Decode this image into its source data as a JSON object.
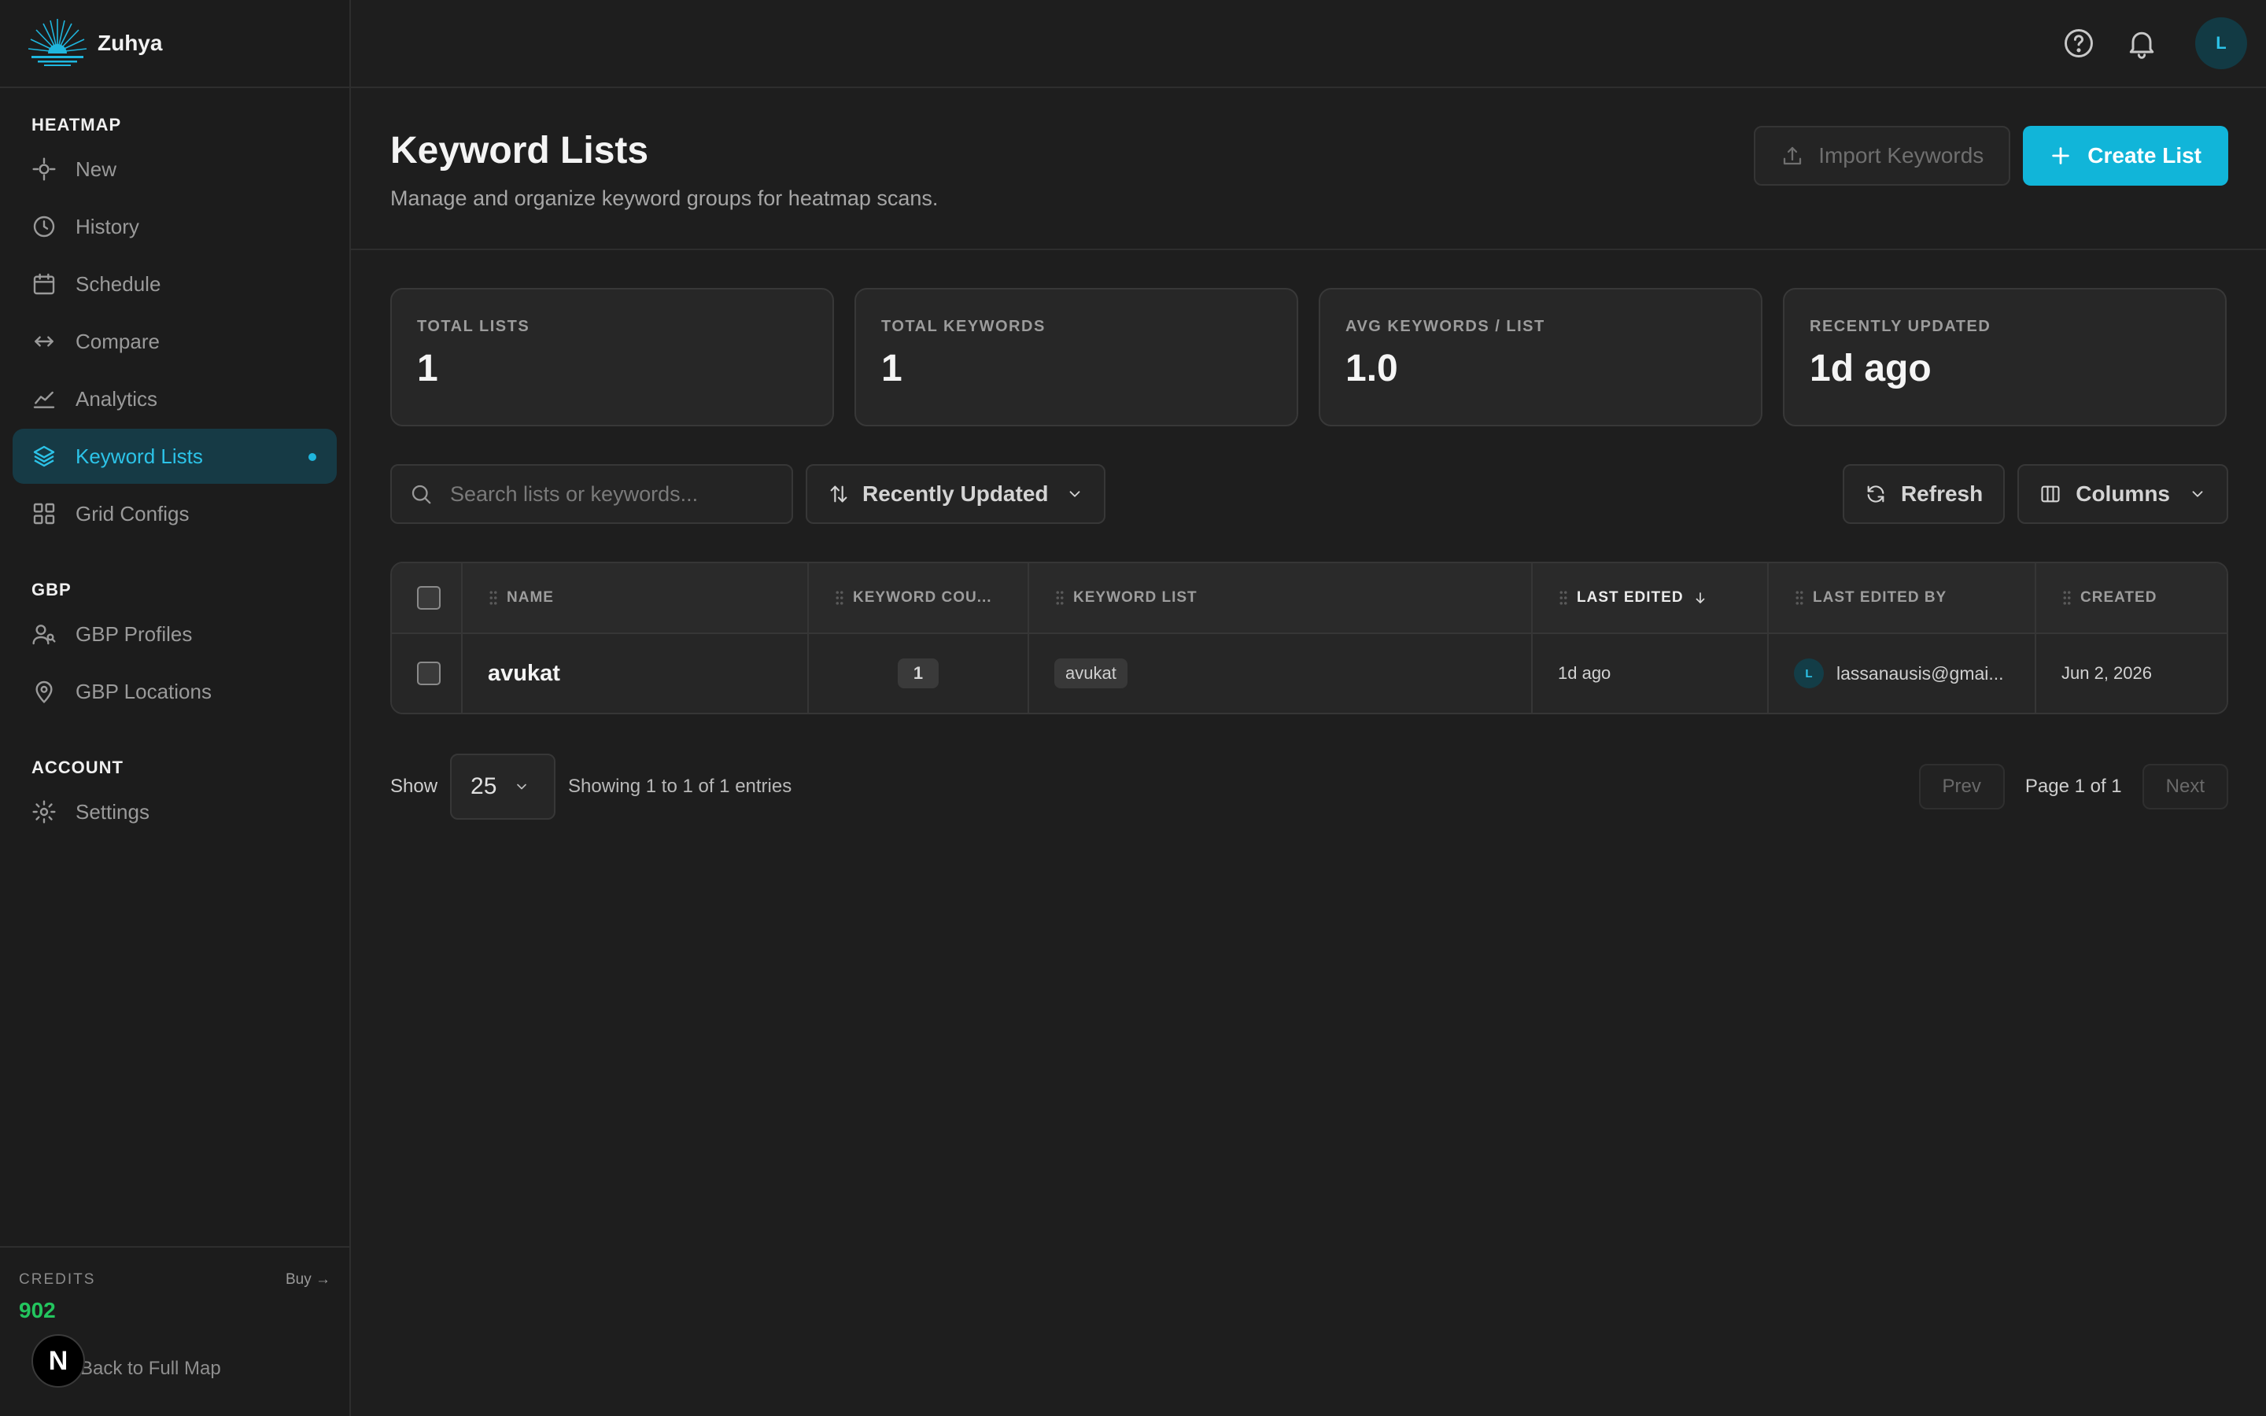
{
  "brand": {
    "name": "Zuhya"
  },
  "sidebar": {
    "sections": [
      {
        "heading": "HEATMAP",
        "items": [
          {
            "label": "New",
            "icon": "crosshair-icon"
          },
          {
            "label": "History",
            "icon": "clock-icon"
          },
          {
            "label": "Schedule",
            "icon": "calendar-icon"
          },
          {
            "label": "Compare",
            "icon": "arrows-horizontal-icon"
          },
          {
            "label": "Analytics",
            "icon": "line-chart-icon"
          },
          {
            "label": "Keyword Lists",
            "icon": "layers-icon",
            "active": true
          },
          {
            "label": "Grid Configs",
            "icon": "grid-icon"
          }
        ]
      },
      {
        "heading": "GBP",
        "items": [
          {
            "label": "GBP Profiles",
            "icon": "users-icon"
          },
          {
            "label": "GBP Locations",
            "icon": "map-pin-icon"
          }
        ]
      },
      {
        "heading": "ACCOUNT",
        "items": [
          {
            "label": "Settings",
            "icon": "gear-icon"
          }
        ]
      }
    ],
    "credits": {
      "label": "CREDITS",
      "buy": "Buy →",
      "value": "902"
    },
    "back_link": "Back to Full Map",
    "badge": "N"
  },
  "topbar": {
    "avatar_initial": "L"
  },
  "header": {
    "title": "Keyword Lists",
    "subtitle": "Manage and organize keyword groups for heatmap scans.",
    "import_label": "Import Keywords",
    "create_label": "Create List"
  },
  "stats": [
    {
      "label": "TOTAL LISTS",
      "value": "1"
    },
    {
      "label": "TOTAL KEYWORDS",
      "value": "1"
    },
    {
      "label": "AVG KEYWORDS / LIST",
      "value": "1.0"
    },
    {
      "label": "RECENTLY UPDATED",
      "value": "1d ago"
    }
  ],
  "toolbar": {
    "search_placeholder": "Search lists or keywords...",
    "sort_label": "Recently Updated",
    "refresh_label": "Refresh",
    "columns_label": "Columns"
  },
  "table": {
    "headers": {
      "name": "NAME",
      "keyword_count": "KEYWORD COU...",
      "keyword_list": "KEYWORD LIST",
      "last_edited": "LAST EDITED",
      "last_edited_by": "LAST EDITED BY",
      "created": "CREATED"
    },
    "rows": [
      {
        "name": "avukat",
        "keyword_count": "1",
        "keyword_list": "avukat",
        "last_edited": "1d ago",
        "editor_initial": "L",
        "last_edited_by": "lassanausis@gmai...",
        "created": "Jun 2, 2026"
      }
    ]
  },
  "pagination": {
    "show_label": "Show",
    "page_size": "25",
    "entries_text": "Showing 1 to 1 of 1 entries",
    "prev_label": "Prev",
    "page_info": "Page 1 of 1",
    "next_label": "Next"
  },
  "colors": {
    "accent": "#11b5d9",
    "credits": "#23c55e",
    "active_bg": "#163a45"
  }
}
